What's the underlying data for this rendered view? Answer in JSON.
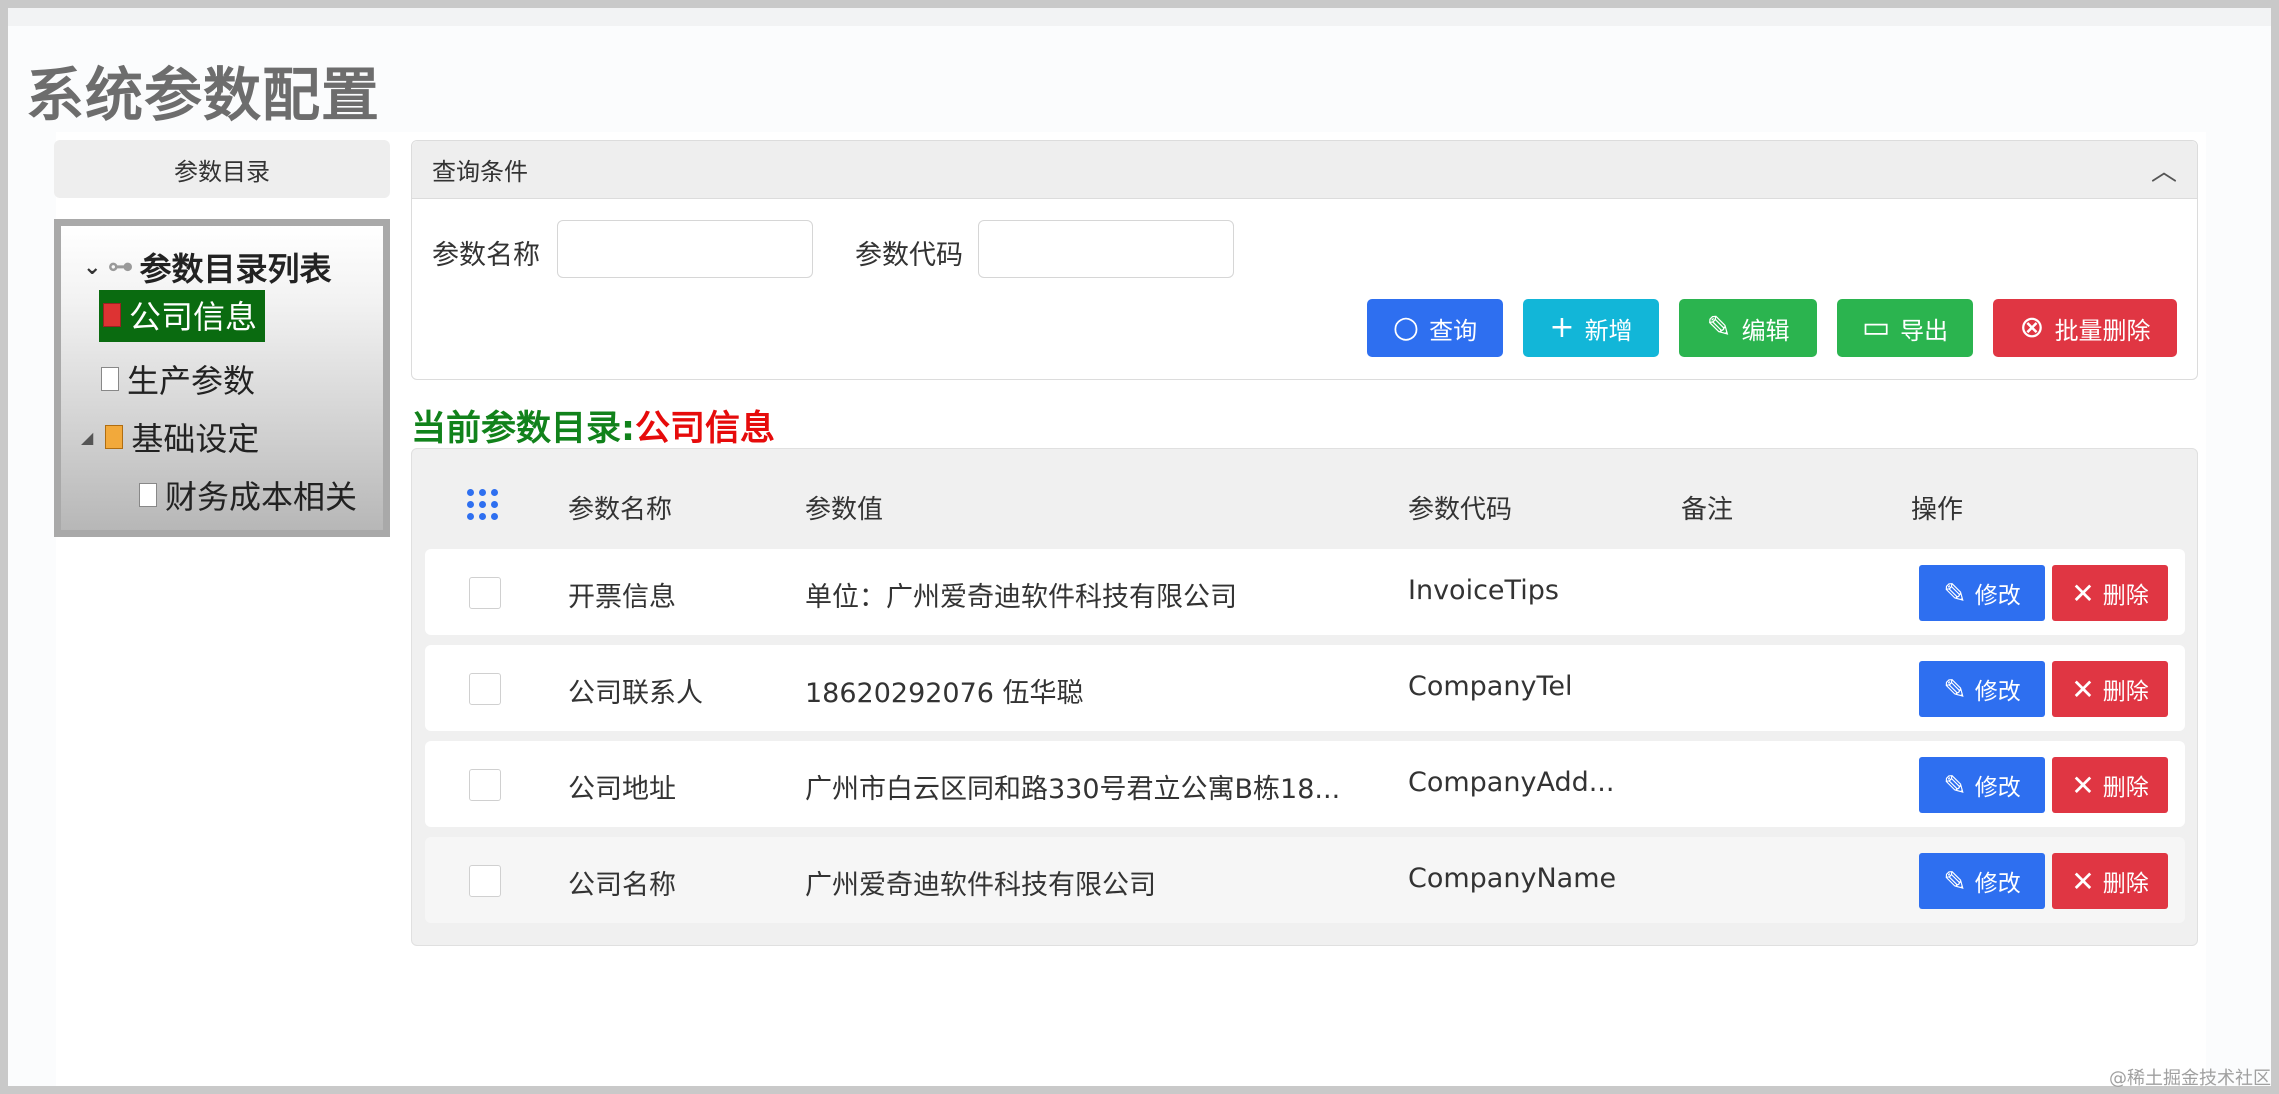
{
  "page": {
    "title": "系统参数配置"
  },
  "sidebar": {
    "header": "参数目录",
    "tree": {
      "root": "参数目录列表",
      "items": [
        {
          "label": "公司信息",
          "selected": true
        },
        {
          "label": "生产参数"
        },
        {
          "label": "基础设定"
        },
        {
          "label": "财务成本相关"
        }
      ]
    }
  },
  "query": {
    "header": "查询条件",
    "fields": [
      {
        "label": "参数名称",
        "value": "",
        "placeholder": ""
      },
      {
        "label": "参数代码",
        "value": "",
        "placeholder": ""
      }
    ],
    "buttons": {
      "search": "查询",
      "add": "新增",
      "edit": "编辑",
      "export": "导出",
      "batch_delete": "批量删除"
    }
  },
  "current": {
    "label": "当前参数目录:",
    "value": "公司信息"
  },
  "table": {
    "headers": [
      "参数名称",
      "参数值",
      "参数代码",
      "备注",
      "操作"
    ],
    "rows": [
      {
        "name": "开票信息",
        "value": "单位：广州爱奇迪软件科技有限公司",
        "code": "InvoiceTips",
        "note": "",
        "edit": "修改",
        "delete": "删除"
      },
      {
        "name": "公司联系人",
        "value": "18620292076 伍华聪",
        "code": "CompanyTel",
        "note": "",
        "edit": "修改",
        "delete": "删除"
      },
      {
        "name": "公司地址",
        "value": "广州市白云区同和路330号君立公寓B栋18...",
        "code": "CompanyAdd...",
        "note": "",
        "edit": "修改",
        "delete": "删除"
      },
      {
        "name": "公司名称",
        "value": "广州爱奇迪软件科技有限公司",
        "code": "CompanyName",
        "note": "",
        "edit": "修改",
        "delete": "删除"
      }
    ]
  },
  "watermark": "@稀土掘金技术社区",
  "colors": {
    "primary": "#2e6ff0",
    "info": "#12b6d8",
    "success": "#2bb44f",
    "danger": "#e03643",
    "tree_selected": "#0a6b10",
    "current_label": "#11821b",
    "current_value": "#e60b0b"
  }
}
